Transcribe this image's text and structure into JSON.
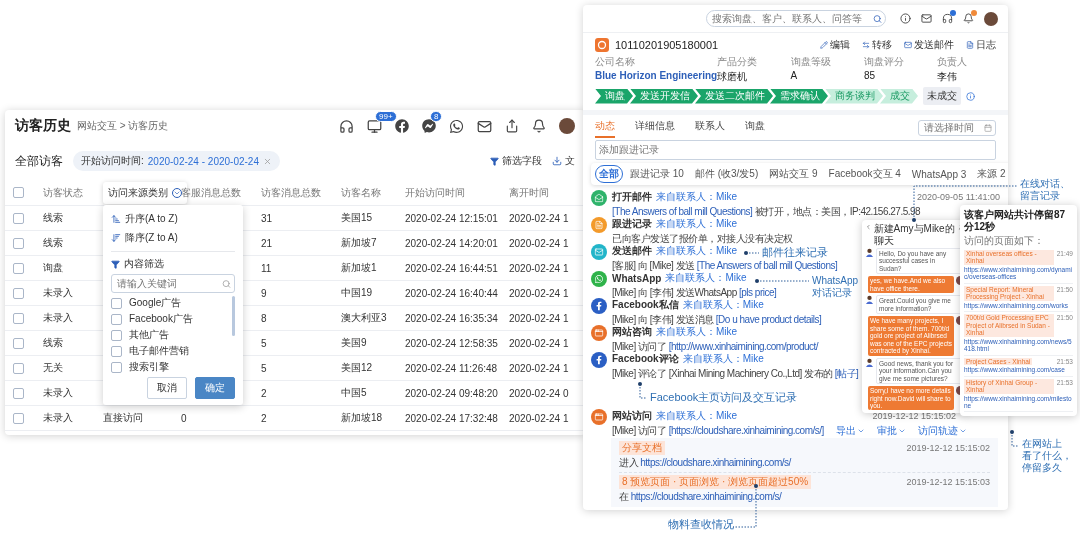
{
  "visitor_history": {
    "title": "访客历史",
    "breadcrumb": "网站交互 > 访客历史",
    "toolbar": [
      {
        "kind": "headset"
      },
      {
        "kind": "monitor",
        "badge": "99+"
      },
      {
        "kind": "facebook"
      },
      {
        "kind": "messenger",
        "badge": "8"
      },
      {
        "kind": "whatsapp"
      },
      {
        "kind": "mail"
      },
      {
        "kind": "share"
      },
      {
        "kind": "bell"
      },
      {
        "kind": "avatar"
      }
    ],
    "section_title": "全部访客",
    "filter_chip": {
      "label": "开始访问时间:",
      "value": "2020-02-24 - 2020-02-24"
    },
    "actions": [
      {
        "kind": "filter",
        "label": "筛选字段"
      },
      {
        "kind": "download",
        "label": "文"
      }
    ],
    "table": {
      "columns": [
        {
          "label": "访客状态",
          "active": false
        },
        {
          "label": "访问来源类别",
          "active": true
        },
        {
          "label": "客服消息总数",
          "active": false
        },
        {
          "label": "访客消息总数",
          "active": false
        },
        {
          "label": "访客名称",
          "active": false
        },
        {
          "label": "开始访问时间",
          "active": false
        },
        {
          "label": "离开时间",
          "active": false
        }
      ],
      "header_checked": false,
      "rows": [
        {
          "checked": false,
          "status": "线索",
          "visitor_messages": "31",
          "name": "美国15",
          "start": "2020-02-24 12:15:01",
          "leave": "2020-02-24 1"
        },
        {
          "checked": false,
          "status": "线索",
          "visitor_messages": "21",
          "name": "新加坡7",
          "start": "2020-02-24 14:20:01",
          "leave": "2020-02-24 1"
        },
        {
          "checked": false,
          "status": "询盘",
          "visitor_messages": "11",
          "name": "新加坡1",
          "start": "2020-02-24 16:44:51",
          "leave": "2020-02-24 1"
        },
        {
          "checked": false,
          "status": "未录入",
          "visitor_messages": "9",
          "name": "中国19",
          "start": "2020-02-24 16:40:44",
          "leave": "2020-02-24 1"
        },
        {
          "checked": false,
          "status": "未录入",
          "visitor_messages": "8",
          "name": "澳大利亚3",
          "start": "2020-02-24 16:35:34",
          "leave": "2020-02-24 1"
        },
        {
          "checked": false,
          "status": "线索",
          "visitor_messages": "5",
          "name": "美国9",
          "start": "2020-02-24 12:58:35",
          "leave": "2020-02-24 1"
        },
        {
          "checked": false,
          "status": "无关",
          "visitor_messages": "5",
          "name": "美国12",
          "start": "2020-02-24 11:26:48",
          "leave": "2020-02-24 1"
        },
        {
          "checked": false,
          "status": "未录入",
          "visitor_messages": "2",
          "name": "中国5",
          "start": "2020-02-24 09:48:20",
          "leave": "2020-02-24 0"
        },
        {
          "checked": false,
          "status": "未录入",
          "source": "直接访问",
          "cs_messages": "0",
          "visitor_messages": "2",
          "name": "新加坡18",
          "start": "2020-02-24 17:32:48",
          "leave": "2020-02-24 1"
        }
      ]
    },
    "column_menu": {
      "sort": [
        {
          "kind": "asc",
          "label": "升序(A to Z)"
        },
        {
          "kind": "desc",
          "label": "降序(Z to A)"
        }
      ],
      "filter_title": "内容筛选",
      "search_placeholder": "请输入关键词",
      "options": [
        {
          "label": "Google广告",
          "checked": false
        },
        {
          "label": "Facebook广告",
          "checked": false
        },
        {
          "label": "其他广告",
          "checked": false
        },
        {
          "label": "电子邮件营销",
          "checked": false
        },
        {
          "label": "搜索引擎",
          "checked": false
        }
      ],
      "buttons": [
        {
          "label": "取消",
          "primary": false
        },
        {
          "label": "确定",
          "primary": true
        }
      ]
    }
  },
  "crm": {
    "search_placeholder": "搜索询盘、客户、联系人、问答等",
    "record_id": "10110201905180001",
    "actions": [
      {
        "kind": "edit",
        "label": "编辑"
      },
      {
        "kind": "transfer",
        "label": "转移"
      },
      {
        "kind": "mail",
        "label": "发送邮件"
      },
      {
        "kind": "log",
        "label": "日志"
      }
    ],
    "fields": [
      {
        "label": "公司名称",
        "value": "Blue Horizon Engineering",
        "kind": "link"
      },
      {
        "label": "产品分类",
        "value": "球磨机",
        "kind": "text"
      },
      {
        "label": "询盘等级",
        "value": "A",
        "kind": "text"
      },
      {
        "label": "询盘评分",
        "value": "85",
        "kind": "text"
      },
      {
        "label": "负责人",
        "value": "李伟",
        "kind": "text"
      }
    ],
    "pipeline": [
      {
        "label": "询盘",
        "done": true
      },
      {
        "label": "发送开发信",
        "done": true
      },
      {
        "label": "发送二次邮件",
        "done": true
      },
      {
        "label": "需求确认",
        "done": true
      },
      {
        "label": "商务谈判",
        "done": false
      },
      {
        "label": "成交",
        "done": false
      }
    ],
    "pipeline_button": "未成交",
    "tabs": [
      {
        "label": "动态",
        "selected": true
      },
      {
        "label": "详细信息",
        "selected": false
      },
      {
        "label": "联系人",
        "selected": false
      },
      {
        "label": "询盘",
        "selected": false
      }
    ],
    "note_placeholder": "添加跟进记录",
    "filters": [
      {
        "label": "全部",
        "selected": true
      },
      {
        "label": "跟进记录 10",
        "selected": false
      },
      {
        "label": "邮件 (收3/发5)",
        "selected": false
      },
      {
        "label": "网站交互 9",
        "selected": false
      },
      {
        "label": "Facebook交互 4",
        "selected": false
      },
      {
        "label": "WhatsApp 3",
        "selected": false
      },
      {
        "label": "来源 2",
        "selected": false
      }
    ],
    "date_placeholder": "请选择时间",
    "timeline": [
      {
        "kind": "mail-open",
        "color": "#2fb36b",
        "title": "打开邮件",
        "source": "来自联系人：Mike",
        "detail": {
          "link": "[The Answers of ball mill Questions]",
          "suffix": " 被打开，地点：美国，IP:42.156.27.5.98"
        },
        "time": "2020-09-05 11:41:00"
      },
      {
        "kind": "note",
        "color": "#f39a2b",
        "title": "跟进记录",
        "source": "来自联系人：Mike",
        "detail": {
          "prefix": "已向客户发送了报价单，对接人没有决定权"
        }
      },
      {
        "kind": "mail",
        "color": "#22b5c9",
        "title": "发送邮件",
        "source": "来自联系人：Mike",
        "detail": {
          "prefix": "[客服] 向 [Mike] 发送 ",
          "link": "[The Answers of ball mill Questions]"
        }
      },
      {
        "kind": "whatsapp",
        "color": "#2fb34a",
        "title": "WhatsApp",
        "source": "来自联系人：Mike",
        "detail": {
          "prefix": "[Mike] 向 [李伟] 发送WhatsApp ",
          "link": "[pls price]"
        }
      },
      {
        "kind": "facebook",
        "color": "#2b5fc4",
        "title": "Facebook私信",
        "source": "来自联系人：Mike",
        "detail": {
          "prefix": "[Mike] 向 [李伟] 发送消息 ",
          "link": "[Do u have product details]"
        }
      },
      {
        "kind": "web",
        "color": "#e8702a",
        "title": "网站咨询",
        "source": "来自联系人：Mike",
        "detail": {
          "prefix": "[Mike] 访问了 ",
          "link": "[http://www.xinhaimining.com/product/"
        }
      },
      {
        "kind": "facebook",
        "color": "#2b5fc4",
        "title": "Facebook评论",
        "source": "来自联系人：Mike",
        "detail": {
          "prefix": "[Mike] 评论了 [Xinhai Mining Machinery Co.,Ltd] 发布的 ",
          "link": "[帖子]"
        }
      },
      {
        "kind": "web",
        "color": "#e8702a",
        "title": "网站访问",
        "source": "来自联系人：Mike",
        "detail": {
          "prefix": "[Mike] 访问了 ",
          "link": "[https://cloudshare.xinhaimining.com/s/]"
        },
        "menus": [
          "导出",
          "审批",
          "访问轨迹"
        ],
        "time": "2019-12-12 15:15:02"
      }
    ],
    "sub_entries": [
      {
        "tag": "分享文档",
        "time": "2019-12-12 15:15:02",
        "text": "进入",
        "link": "https://cloudshare.xinhaimining.com/s/"
      },
      {
        "tag": "8 预览页面 · 页面浏览 · 浏览页面超过50%",
        "time": "2019-12-12 15:15:03",
        "text": "在",
        "link": "https://cloudshare.xinhaimining.com/s/"
      }
    ]
  },
  "chat": {
    "title": "新建Amy与Mike的聊天",
    "messages": [
      {
        "kind": "incoming",
        "text": "Hello, Do you have any successful cases in Sudan?"
      },
      {
        "kind": "outgoing",
        "text": "yes, we have.And we also have office there."
      },
      {
        "kind": "incoming",
        "text": "Great.Could you give me more information?"
      },
      {
        "kind": "outgoing",
        "text": "We have many projects, I share some of them. 700t/d gold ore project of Alibrsed was one of the EPC projects contracted by Xinhai."
      },
      {
        "kind": "incoming",
        "text": "Good news, thank you for your information.Can you give me some pictures?"
      },
      {
        "kind": "outgoing",
        "text": "Sorry,I have no more details right now.David will share to you."
      }
    ]
  },
  "visits": {
    "title": "该客户网站共计停留87分12秒",
    "subtitle": "访问的页面如下：",
    "pages": [
      {
        "title": "Xinhai overseas offices - Xinhai",
        "time": "21:49",
        "url": "https://www.xinhaimining.com/dynamic/overseas-offices"
      },
      {
        "title": "Special Report: Mineral Processing Project - Xinhai",
        "time": "21:50",
        "url": "https://www.xinhaimining.com/works"
      },
      {
        "title": "700t/d Gold Processing EPC Project of Alibrsed in Sudan - Xinhai",
        "time": "21:50",
        "url": "https://www.xinhaimining.com/news/5418.html"
      },
      {
        "title": "Project Cases - Xinhai",
        "time": "21:53",
        "url": "https://www.xinhaimining.com/case"
      },
      {
        "title": "History of Xinhai Group - Xinhai",
        "time": "21:53",
        "url": "https://www.xinhaimining.com/milestone"
      }
    ]
  },
  "callouts": [
    {
      "lines": [
        "在线对话、",
        "留言记录"
      ]
    },
    {
      "lines": [
        "邮件往来记录"
      ]
    },
    {
      "lines": [
        "WhatsApp",
        "对话记录"
      ]
    },
    {
      "lines": [
        "在网站上",
        "看了什么，",
        "停留多久"
      ]
    },
    {
      "lines": [
        "Facebook主页访问及交互记录"
      ]
    },
    {
      "lines": [
        "物料查收情况"
      ]
    }
  ]
}
